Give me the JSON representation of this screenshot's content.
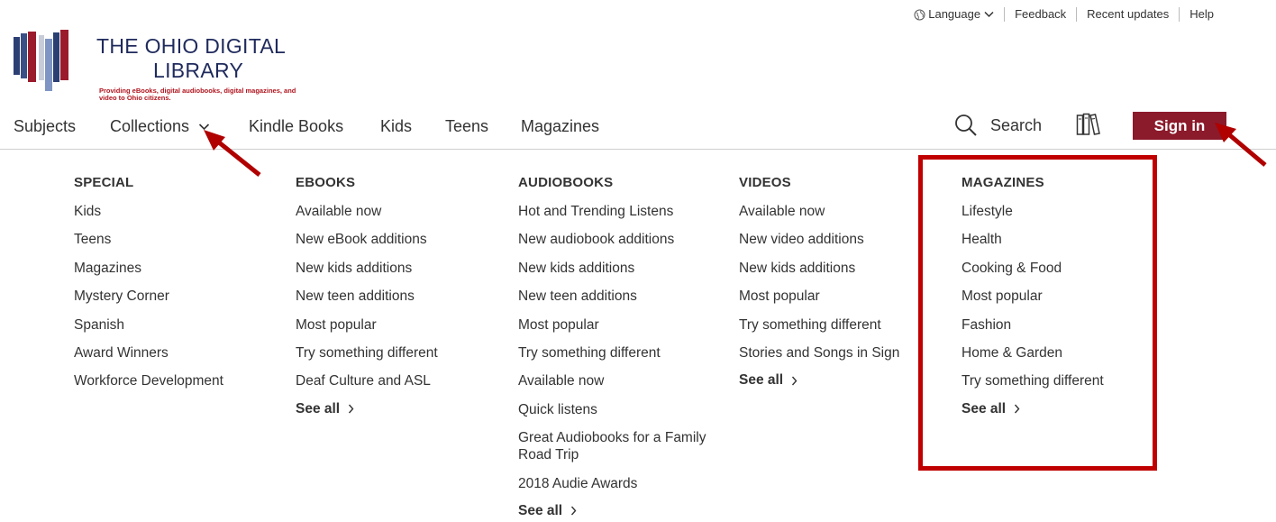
{
  "utility": {
    "language": "Language",
    "feedback": "Feedback",
    "recent_updates": "Recent updates",
    "help": "Help"
  },
  "logo": {
    "title_line1": "THE OHIO DIGITAL",
    "title_line2": "LIBRARY",
    "tagline": "Providing eBooks, digital audiobooks, digital magazines, and video to Ohio citizens."
  },
  "nav": {
    "subjects": "Subjects",
    "collections": "Collections",
    "kindle_books": "Kindle Books",
    "kids": "Kids",
    "teens": "Teens",
    "magazines": "Magazines",
    "search": "Search",
    "sign_in": "Sign in"
  },
  "menu": {
    "special": {
      "heading": "SPECIAL",
      "links": [
        "Kids",
        "Teens",
        "Magazines",
        "Mystery Corner",
        "Spanish",
        "Award Winners",
        "Workforce Development"
      ]
    },
    "ebooks": {
      "heading": "EBOOKS",
      "links": [
        "Available now",
        "New eBook additions",
        "New kids additions",
        "New teen additions",
        "Most popular",
        "Try something different",
        "Deaf Culture and ASL"
      ],
      "see_all": "See all"
    },
    "audiobooks": {
      "heading": "AUDIOBOOKS",
      "links": [
        "Hot and Trending Listens",
        "New audiobook additions",
        "New kids additions",
        "New teen additions",
        "Most popular",
        "Try something different",
        "Available now",
        "Quick listens",
        "Great Audiobooks for a Family Road Trip",
        "2018 Audie Awards"
      ],
      "see_all": "See all"
    },
    "videos": {
      "heading": "VIDEOS",
      "links": [
        "Available now",
        "New video additions",
        "New kids additions",
        "Most popular",
        "Try something different",
        "Stories and Songs in Sign"
      ],
      "see_all": "See all"
    },
    "magazines": {
      "heading": "MAGAZINES",
      "links": [
        "Lifestyle",
        "Health",
        "Cooking & Food",
        "Most popular",
        "Fashion",
        "Home & Garden",
        "Try something different"
      ],
      "see_all": "See all"
    }
  },
  "colors": {
    "brand_red": "#8b1a2b",
    "annotation_red": "#c00000",
    "logo_navy": "#1f2a5c"
  }
}
